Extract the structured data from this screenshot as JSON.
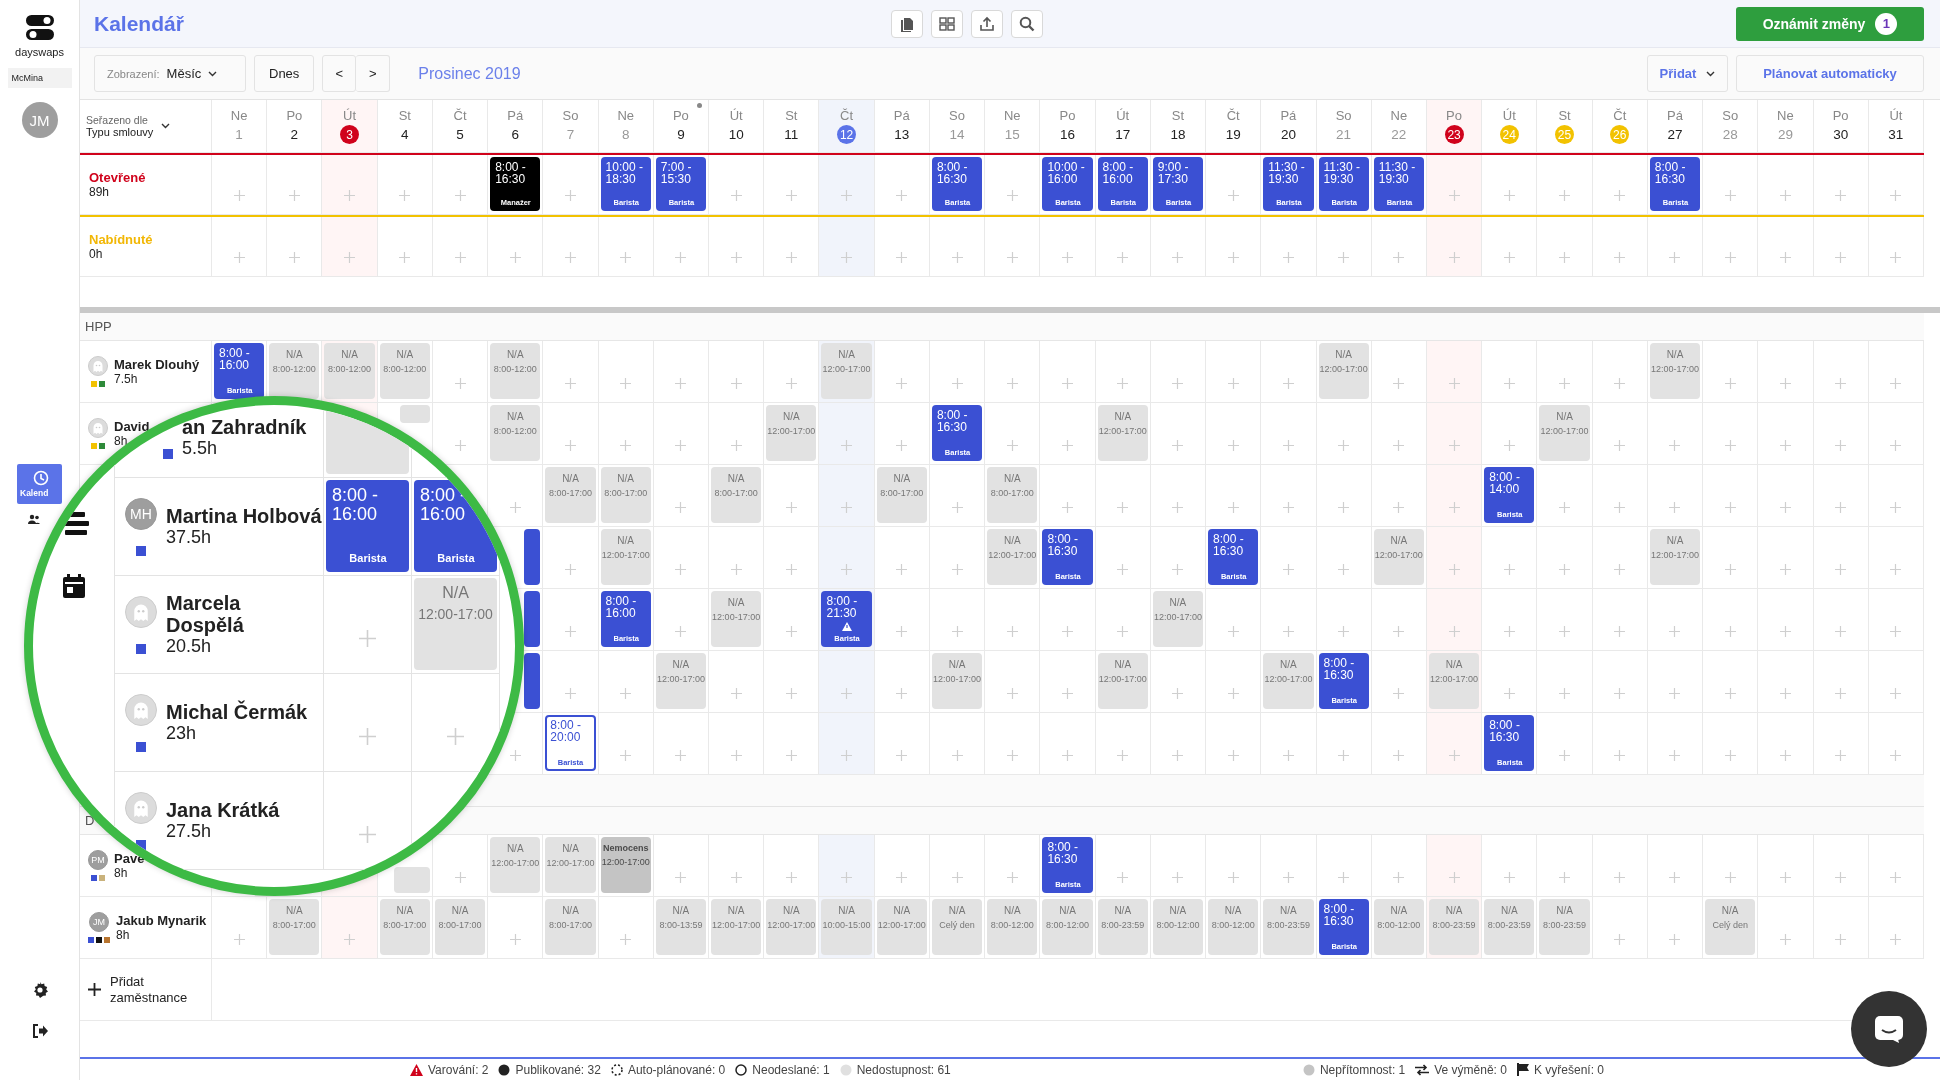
{
  "sidebar": {
    "logo": "dayswaps",
    "workspace": "McMina",
    "user_initials": "JM",
    "nav": [
      {
        "kind": "calendar",
        "label": "Kalend",
        "selected": true
      },
      {
        "kind": "people",
        "selected": false
      }
    ]
  },
  "topbar": {
    "title": "Kalendář",
    "publish": "Oznámit změny",
    "publish_count": "1"
  },
  "toolbar": {
    "view_label": "Zobrazení:",
    "view_value": "Měsíc",
    "today": "Dnes",
    "prev": "<",
    "next": ">",
    "period": "Prosinec 2019",
    "add": "Přidat",
    "auto": "Plánovat automaticky"
  },
  "sort": {
    "label": "Seřazeno dle",
    "value": "Typu smlouvy"
  },
  "days": [
    {
      "weekday": "Ne",
      "day": "1",
      "kind": "weekend",
      "marked": false
    },
    {
      "weekday": "Po",
      "day": "2",
      "kind": "plain",
      "marked": false
    },
    {
      "weekday": "Út",
      "day": "3",
      "kind": "holiday",
      "marked": false
    },
    {
      "weekday": "St",
      "day": "4",
      "kind": "plain",
      "marked": false
    },
    {
      "weekday": "Čt",
      "day": "5",
      "kind": "plain",
      "marked": false
    },
    {
      "weekday": "Pá",
      "day": "6",
      "kind": "plain",
      "marked": false
    },
    {
      "weekday": "So",
      "day": "7",
      "kind": "weekend",
      "marked": false
    },
    {
      "weekday": "Ne",
      "day": "8",
      "kind": "weekend",
      "marked": false
    },
    {
      "weekday": "Po",
      "day": "9",
      "kind": "plain",
      "marked": true
    },
    {
      "weekday": "Út",
      "day": "10",
      "kind": "plain",
      "marked": false
    },
    {
      "weekday": "St",
      "day": "11",
      "kind": "plain",
      "marked": false
    },
    {
      "weekday": "Čt",
      "day": "12",
      "kind": "today",
      "marked": false
    },
    {
      "weekday": "Pá",
      "day": "13",
      "kind": "plain",
      "marked": false
    },
    {
      "weekday": "So",
      "day": "14",
      "kind": "weekend",
      "marked": false
    },
    {
      "weekday": "Ne",
      "day": "15",
      "kind": "weekend",
      "marked": false
    },
    {
      "weekday": "Po",
      "day": "16",
      "kind": "plain",
      "marked": false
    },
    {
      "weekday": "Út",
      "day": "17",
      "kind": "plain",
      "marked": false
    },
    {
      "weekday": "St",
      "day": "18",
      "kind": "plain",
      "marked": false
    },
    {
      "weekday": "Čt",
      "day": "19",
      "kind": "plain",
      "marked": false
    },
    {
      "weekday": "Pá",
      "day": "20",
      "kind": "plain",
      "marked": false
    },
    {
      "weekday": "So",
      "day": "21",
      "kind": "weekend",
      "marked": false
    },
    {
      "weekday": "Ne",
      "day": "22",
      "kind": "weekend",
      "marked": false
    },
    {
      "weekday": "Po",
      "day": "23",
      "kind": "holiday",
      "marked": false
    },
    {
      "weekday": "Út",
      "day": "24",
      "kind": "leave",
      "marked": false
    },
    {
      "weekday": "St",
      "day": "25",
      "kind": "leave",
      "marked": false
    },
    {
      "weekday": "Čt",
      "day": "26",
      "kind": "leave",
      "marked": false
    },
    {
      "weekday": "Pá",
      "day": "27",
      "kind": "plain",
      "marked": false
    },
    {
      "weekday": "So",
      "day": "28",
      "kind": "weekend",
      "marked": false
    },
    {
      "weekday": "Ne",
      "day": "29",
      "kind": "weekend",
      "marked": false
    },
    {
      "weekday": "Po",
      "day": "30",
      "kind": "plain",
      "marked": false
    },
    {
      "weekday": "Út",
      "day": "31",
      "kind": "plain",
      "marked": false
    }
  ],
  "open_rows": [
    {
      "kind": "open",
      "label": "Otevřené",
      "hours": "89h",
      "cells": [
        {
          "kind": "add"
        },
        {
          "kind": "add"
        },
        {
          "kind": "add"
        },
        {
          "kind": "add"
        },
        {
          "kind": "add"
        },
        {
          "kind": "shift",
          "time": "8:00 - 16:30",
          "role": "Manažer",
          "color": "#000000"
        },
        {
          "kind": "add"
        },
        {
          "kind": "shift",
          "time": "10:00 - 18:30",
          "role": "Barista",
          "color": "#3b50d3"
        },
        {
          "kind": "shift",
          "time": "7:00 - 15:30",
          "role": "Barista",
          "color": "#3b50d3"
        },
        {
          "kind": "add"
        },
        {
          "kind": "add"
        },
        {
          "kind": "add"
        },
        {
          "kind": "add"
        },
        {
          "kind": "shift",
          "time": "8:00 - 16:30",
          "role": "Barista",
          "color": "#3b50d3"
        },
        {
          "kind": "add"
        },
        {
          "kind": "shift",
          "time": "10:00 - 16:00",
          "role": "Barista",
          "color": "#3b50d3"
        },
        {
          "kind": "shift",
          "time": "8:00 - 16:00",
          "role": "Barista",
          "color": "#3b50d3"
        },
        {
          "kind": "shift",
          "time": "9:00 - 17:30",
          "role": "Barista",
          "color": "#3b50d3"
        },
        {
          "kind": "add"
        },
        {
          "kind": "shift",
          "time": "11:30 - 19:30",
          "role": "Barista",
          "color": "#3b50d3"
        },
        {
          "kind": "shift",
          "time": "11:30 - 19:30",
          "role": "Barista",
          "color": "#3b50d3"
        },
        {
          "kind": "shift",
          "time": "11:30 - 19:30",
          "role": "Barista",
          "color": "#3b50d3"
        },
        {
          "kind": "add"
        },
        {
          "kind": "add"
        },
        {
          "kind": "add"
        },
        {
          "kind": "add"
        },
        {
          "kind": "shift",
          "time": "8:00 - 16:30",
          "role": "Barista",
          "color": "#3b50d3"
        },
        {
          "kind": "add"
        },
        {
          "kind": "add"
        },
        {
          "kind": "add"
        },
        {
          "kind": "add"
        }
      ]
    },
    {
      "kind": "offered",
      "label": "Nabídnuté",
      "hours": "0h",
      "cells": [
        {
          "kind": "add"
        },
        {
          "kind": "add"
        },
        {
          "kind": "add"
        },
        {
          "kind": "add"
        },
        {
          "kind": "add"
        },
        {
          "kind": "add"
        },
        {
          "kind": "add"
        },
        {
          "kind": "add"
        },
        {
          "kind": "add"
        },
        {
          "kind": "add"
        },
        {
          "kind": "add"
        },
        {
          "kind": "add"
        },
        {
          "kind": "add"
        },
        {
          "kind": "add"
        },
        {
          "kind": "add"
        },
        {
          "kind": "add"
        },
        {
          "kind": "add"
        },
        {
          "kind": "add"
        },
        {
          "kind": "add"
        },
        {
          "kind": "add"
        },
        {
          "kind": "add"
        },
        {
          "kind": "add"
        },
        {
          "kind": "add"
        },
        {
          "kind": "add"
        },
        {
          "kind": "add"
        },
        {
          "kind": "add"
        },
        {
          "kind": "add"
        },
        {
          "kind": "add"
        },
        {
          "kind": "add"
        },
        {
          "kind": "add"
        },
        {
          "kind": "add"
        }
      ]
    }
  ],
  "sections": [
    {
      "title": "HPP",
      "employees": [
        {
          "name": "Marek Dlouhý",
          "hours": "7.5h",
          "avatar": {
            "kind": "ghost"
          },
          "tags": [
            {
              "color": "#f2c200"
            },
            {
              "color": "#2e8b3a"
            }
          ],
          "cells": [
            {
              "kind": "shift",
              "time": "8:00 - 16:00",
              "role": "Barista",
              "color": "#3b50d3"
            },
            {
              "kind": "na",
              "label": "N/A",
              "time": "8:00-12:00"
            },
            {
              "kind": "na",
              "label": "N/A",
              "time": "8:00-12:00"
            },
            {
              "kind": "na",
              "label": "N/A",
              "time": "8:00-12:00"
            },
            {
              "kind": "add"
            },
            {
              "kind": "na",
              "label": "N/A",
              "time": "8:00-12:00"
            },
            {
              "kind": "add"
            },
            {
              "kind": "add"
            },
            {
              "kind": "add"
            },
            {
              "kind": "add"
            },
            {
              "kind": "add"
            },
            {
              "kind": "na",
              "label": "N/A",
              "time": "12:00-17:00"
            },
            {
              "kind": "add"
            },
            {
              "kind": "add"
            },
            {
              "kind": "add"
            },
            {
              "kind": "add"
            },
            {
              "kind": "add"
            },
            {
              "kind": "add"
            },
            {
              "kind": "add"
            },
            {
              "kind": "add"
            },
            {
              "kind": "na",
              "label": "N/A",
              "time": "12:00-17:00"
            },
            {
              "kind": "add"
            },
            {
              "kind": "add"
            },
            {
              "kind": "add"
            },
            {
              "kind": "add"
            },
            {
              "kind": "add"
            },
            {
              "kind": "na",
              "label": "N/A",
              "time": "12:00-17:00"
            },
            {
              "kind": "add"
            },
            {
              "kind": "add"
            },
            {
              "kind": "add"
            },
            {
              "kind": "add"
            }
          ]
        },
        {
          "name": "David",
          "hours": "8h",
          "avatar": {
            "kind": "ghost"
          },
          "tags": [
            {
              "color": "#f2c200"
            },
            {
              "color": "#2e8b3a"
            }
          ],
          "cells": [
            {
              "kind": "empty"
            },
            {
              "kind": "empty"
            },
            {
              "kind": "empty"
            },
            {
              "kind": "part_na"
            },
            {
              "kind": "add"
            },
            {
              "kind": "na",
              "label": "N/A",
              "time": "8:00-12:00"
            },
            {
              "kind": "add"
            },
            {
              "kind": "add"
            },
            {
              "kind": "add"
            },
            {
              "kind": "add"
            },
            {
              "kind": "na",
              "label": "N/A",
              "time": "12:00-17:00"
            },
            {
              "kind": "add"
            },
            {
              "kind": "add"
            },
            {
              "kind": "shift",
              "time": "8:00 - 16:30",
              "role": "Barista",
              "color": "#3b50d3"
            },
            {
              "kind": "add"
            },
            {
              "kind": "add"
            },
            {
              "kind": "na",
              "label": "N/A",
              "time": "12:00-17:00"
            },
            {
              "kind": "add"
            },
            {
              "kind": "add"
            },
            {
              "kind": "add"
            },
            {
              "kind": "add"
            },
            {
              "kind": "add"
            },
            {
              "kind": "add"
            },
            {
              "kind": "add"
            },
            {
              "kind": "na",
              "label": "N/A",
              "time": "12:00-17:00"
            },
            {
              "kind": "add"
            },
            {
              "kind": "add"
            },
            {
              "kind": "add"
            },
            {
              "kind": "add"
            },
            {
              "kind": "add"
            },
            {
              "kind": "add"
            }
          ]
        },
        {
          "cells": [
            {
              "kind": "empty"
            },
            {
              "kind": "empty"
            },
            {
              "kind": "hidden"
            },
            {
              "kind": "empty"
            },
            {
              "kind": "empty"
            },
            {
              "kind": "add"
            },
            {
              "kind": "na",
              "label": "N/A",
              "time": "8:00-17:00"
            },
            {
              "kind": "na",
              "label": "N/A",
              "time": "8:00-17:00"
            },
            {
              "kind": "add"
            },
            {
              "kind": "na",
              "label": "N/A",
              "time": "8:00-17:00"
            },
            {
              "kind": "add"
            },
            {
              "kind": "add"
            },
            {
              "kind": "na",
              "label": "N/A",
              "time": "8:00-17:00"
            },
            {
              "kind": "add"
            },
            {
              "kind": "na",
              "label": "N/A",
              "time": "8:00-17:00"
            },
            {
              "kind": "add"
            },
            {
              "kind": "add"
            },
            {
              "kind": "add"
            },
            {
              "kind": "add"
            },
            {
              "kind": "add"
            },
            {
              "kind": "add"
            },
            {
              "kind": "add"
            },
            {
              "kind": "add"
            },
            {
              "kind": "shift",
              "time": "8:00 - 14:00",
              "role": "Barista",
              "color": "#3b50d3"
            },
            {
              "kind": "add"
            },
            {
              "kind": "add"
            },
            {
              "kind": "add"
            },
            {
              "kind": "add"
            },
            {
              "kind": "add"
            },
            {
              "kind": "add"
            },
            {
              "kind": "add"
            }
          ]
        },
        {
          "cells": [
            {
              "kind": "empty"
            },
            {
              "kind": "empty"
            },
            {
              "kind": "hidden"
            },
            {
              "kind": "empty"
            },
            {
              "kind": "empty"
            },
            {
              "kind": "part_shift",
              "color": "#3b50d3"
            },
            {
              "kind": "add"
            },
            {
              "kind": "na",
              "label": "N/A",
              "time": "12:00-17:00"
            },
            {
              "kind": "add"
            },
            {
              "kind": "add"
            },
            {
              "kind": "add"
            },
            {
              "kind": "add"
            },
            {
              "kind": "add"
            },
            {
              "kind": "add"
            },
            {
              "kind": "na",
              "label": "N/A",
              "time": "12:00-17:00"
            },
            {
              "kind": "shift",
              "time": "8:00 - 16:30",
              "role": "Barista",
              "color": "#3b50d3"
            },
            {
              "kind": "add"
            },
            {
              "kind": "add"
            },
            {
              "kind": "shift",
              "time": "8:00 - 16:30",
              "role": "Barista",
              "color": "#3b50d3"
            },
            {
              "kind": "add"
            },
            {
              "kind": "add"
            },
            {
              "kind": "na",
              "label": "N/A",
              "time": "12:00-17:00"
            },
            {
              "kind": "add"
            },
            {
              "kind": "add"
            },
            {
              "kind": "add"
            },
            {
              "kind": "add"
            },
            {
              "kind": "na",
              "label": "N/A",
              "time": "12:00-17:00"
            },
            {
              "kind": "add"
            },
            {
              "kind": "add"
            },
            {
              "kind": "add"
            },
            {
              "kind": "add"
            }
          ]
        },
        {
          "cells": [
            {
              "kind": "empty"
            },
            {
              "kind": "empty"
            },
            {
              "kind": "hidden"
            },
            {
              "kind": "empty"
            },
            {
              "kind": "empty"
            },
            {
              "kind": "part_shift",
              "color": "#3b50d3"
            },
            {
              "kind": "add"
            },
            {
              "kind": "shift",
              "time": "8:00 - 16:00",
              "role": "Barista",
              "color": "#3b50d3"
            },
            {
              "kind": "add"
            },
            {
              "kind": "na",
              "label": "N/A",
              "time": "12:00-17:00"
            },
            {
              "kind": "add"
            },
            {
              "kind": "alert",
              "time": "8:00 - 21:30",
              "role": "Barista",
              "color": "#3b50d3"
            },
            {
              "kind": "add"
            },
            {
              "kind": "add"
            },
            {
              "kind": "add"
            },
            {
              "kind": "add"
            },
            {
              "kind": "add"
            },
            {
              "kind": "na",
              "label": "N/A",
              "time": "12:00-17:00"
            },
            {
              "kind": "add"
            },
            {
              "kind": "add"
            },
            {
              "kind": "add"
            },
            {
              "kind": "add"
            },
            {
              "kind": "add"
            },
            {
              "kind": "add"
            },
            {
              "kind": "add"
            },
            {
              "kind": "add"
            },
            {
              "kind": "add"
            },
            {
              "kind": "add"
            },
            {
              "kind": "add"
            },
            {
              "kind": "add"
            },
            {
              "kind": "add"
            }
          ]
        },
        {
          "cells": [
            {
              "kind": "empty"
            },
            {
              "kind": "empty"
            },
            {
              "kind": "hidden"
            },
            {
              "kind": "empty"
            },
            {
              "kind": "empty"
            },
            {
              "kind": "part_shift",
              "color": "#3b50d3"
            },
            {
              "kind": "add"
            },
            {
              "kind": "add"
            },
            {
              "kind": "na",
              "label": "N/A",
              "time": "12:00-17:00"
            },
            {
              "kind": "add"
            },
            {
              "kind": "add"
            },
            {
              "kind": "add"
            },
            {
              "kind": "add"
            },
            {
              "kind": "na",
              "label": "N/A",
              "time": "12:00-17:00"
            },
            {
              "kind": "add"
            },
            {
              "kind": "add"
            },
            {
              "kind": "na",
              "label": "N/A",
              "time": "12:00-17:00"
            },
            {
              "kind": "add"
            },
            {
              "kind": "add"
            },
            {
              "kind": "na",
              "label": "N/A",
              "time": "12:00-17:00"
            },
            {
              "kind": "shift",
              "time": "8:00 - 16:30",
              "role": "Barista",
              "color": "#3b50d3"
            },
            {
              "kind": "add"
            },
            {
              "kind": "na",
              "label": "N/A",
              "time": "12:00-17:00"
            },
            {
              "kind": "add"
            },
            {
              "kind": "add"
            },
            {
              "kind": "add"
            },
            {
              "kind": "add"
            },
            {
              "kind": "add"
            },
            {
              "kind": "add"
            },
            {
              "kind": "add"
            },
            {
              "kind": "add"
            }
          ]
        },
        {
          "cells": [
            {
              "kind": "empty"
            },
            {
              "kind": "empty"
            },
            {
              "kind": "empty"
            },
            {
              "kind": "empty"
            },
            {
              "kind": "empty"
            },
            {
              "kind": "add"
            },
            {
              "kind": "draft",
              "time": "8:00 - 20:00",
              "role": "Barista",
              "color": "#3b50d3"
            },
            {
              "kind": "add"
            },
            {
              "kind": "add"
            },
            {
              "kind": "add"
            },
            {
              "kind": "add"
            },
            {
              "kind": "add"
            },
            {
              "kind": "add"
            },
            {
              "kind": "add"
            },
            {
              "kind": "add"
            },
            {
              "kind": "add"
            },
            {
              "kind": "add"
            },
            {
              "kind": "add"
            },
            {
              "kind": "add"
            },
            {
              "kind": "add"
            },
            {
              "kind": "add"
            },
            {
              "kind": "add"
            },
            {
              "kind": "add"
            },
            {
              "kind": "shift",
              "time": "8:00 - 16:30",
              "role": "Barista",
              "color": "#3b50d3"
            },
            {
              "kind": "add"
            },
            {
              "kind": "add"
            },
            {
              "kind": "add"
            },
            {
              "kind": "add"
            },
            {
              "kind": "add"
            },
            {
              "kind": "add"
            },
            {
              "kind": "add"
            }
          ]
        }
      ]
    },
    {
      "title": "D",
      "employees": [
        {
          "name": "Pave",
          "hours": "8h",
          "avatar": {
            "kind": "initials",
            "text": "PM"
          },
          "tags": [
            {
              "color": "#3b50d3"
            },
            {
              "color": "#c9b27c"
            }
          ],
          "cells": [
            {
              "kind": "empty"
            },
            {
              "kind": "empty"
            },
            {
              "kind": "empty"
            },
            {
              "kind": "part_na_low"
            },
            {
              "kind": "add"
            },
            {
              "kind": "na",
              "label": "N/A",
              "time": "12:00-17:00"
            },
            {
              "kind": "na",
              "label": "N/A",
              "time": "12:00-17:00"
            },
            {
              "kind": "sick",
              "label": "Nemocens",
              "time": "12:00-17:00"
            },
            {
              "kind": "add"
            },
            {
              "kind": "add"
            },
            {
              "kind": "add"
            },
            {
              "kind": "add"
            },
            {
              "kind": "add"
            },
            {
              "kind": "add"
            },
            {
              "kind": "add"
            },
            {
              "kind": "shift",
              "time": "8:00 - 16:30",
              "role": "Barista",
              "color": "#3b50d3"
            },
            {
              "kind": "add"
            },
            {
              "kind": "add"
            },
            {
              "kind": "add"
            },
            {
              "kind": "add"
            },
            {
              "kind": "add"
            },
            {
              "kind": "add"
            },
            {
              "kind": "add"
            },
            {
              "kind": "add"
            },
            {
              "kind": "add"
            },
            {
              "kind": "add"
            },
            {
              "kind": "add"
            },
            {
              "kind": "add"
            },
            {
              "kind": "add"
            },
            {
              "kind": "add"
            },
            {
              "kind": "add"
            }
          ]
        },
        {
          "name": "Jakub Mynarik",
          "hours": "8h",
          "avatar": {
            "kind": "initials",
            "text": "JM"
          },
          "tags": [
            {
              "color": "#3b50d3"
            },
            {
              "color": "#111111"
            },
            {
              "color": "#b8752f"
            }
          ],
          "cells": [
            {
              "kind": "add"
            },
            {
              "kind": "na",
              "label": "N/A",
              "time": "8:00-17:00"
            },
            {
              "kind": "add"
            },
            {
              "kind": "na",
              "label": "N/A",
              "time": "8:00-17:00"
            },
            {
              "kind": "na",
              "label": "N/A",
              "time": "8:00-17:00"
            },
            {
              "kind": "add"
            },
            {
              "kind": "na",
              "label": "N/A",
              "time": "8:00-17:00"
            },
            {
              "kind": "add"
            },
            {
              "kind": "na",
              "label": "N/A",
              "time": "8:00-13:59"
            },
            {
              "kind": "na",
              "label": "N/A",
              "time": "12:00-17:00"
            },
            {
              "kind": "na",
              "label": "N/A",
              "time": "12:00-17:00"
            },
            {
              "kind": "na",
              "label": "N/A",
              "time": "10:00-15:00"
            },
            {
              "kind": "na",
              "label": "N/A",
              "time": "12:00-17:00"
            },
            {
              "kind": "na",
              "label": "N/A",
              "time": "Celý den"
            },
            {
              "kind": "na",
              "label": "N/A",
              "time": "8:00-12:00"
            },
            {
              "kind": "na",
              "label": "N/A",
              "time": "8:00-12:00"
            },
            {
              "kind": "na",
              "label": "N/A",
              "time": "8:00-23:59"
            },
            {
              "kind": "na",
              "label": "N/A",
              "time": "8:00-12:00"
            },
            {
              "kind": "na",
              "label": "N/A",
              "time": "8:00-12:00"
            },
            {
              "kind": "na",
              "label": "N/A",
              "time": "8:00-23:59"
            },
            {
              "kind": "shift",
              "time": "8:00 - 16:30",
              "role": "Barista",
              "color": "#3b50d3"
            },
            {
              "kind": "na",
              "label": "N/A",
              "time": "8:00-12:00"
            },
            {
              "kind": "na",
              "label": "N/A",
              "time": "8:00-23:59"
            },
            {
              "kind": "na",
              "label": "N/A",
              "time": "8:00-23:59"
            },
            {
              "kind": "na",
              "label": "N/A",
              "time": "8:00-23:59"
            },
            {
              "kind": "add"
            },
            {
              "kind": "add"
            },
            {
              "kind": "na",
              "label": "N/A",
              "time": "Celý den"
            },
            {
              "kind": "add"
            },
            {
              "kind": "add"
            },
            {
              "kind": "add"
            }
          ]
        }
      ]
    }
  ],
  "add_employee": "Přidat zaměstnance",
  "lens": {
    "rows": [
      {
        "name": "an Zahradník",
        "hours": "5.5h",
        "tags": [
          {
            "color": "#3b50d3"
          }
        ],
        "cells": [
          {
            "kind": "part_na"
          },
          {
            "kind": "empty"
          }
        ]
      },
      {
        "name": "Martina Holbová",
        "hours": "37.5h",
        "avatar": {
          "kind": "initials",
          "text": "MH"
        },
        "tags": [
          {
            "color": "#3b50d3"
          }
        ],
        "cells": [
          {
            "kind": "shift",
            "time": "8:00 - 16:00",
            "role": "Barista",
            "color": "#3b50d3"
          },
          {
            "kind": "shift",
            "time": "8:00 - 16:00",
            "role": "Barista",
            "color": "#3b50d3"
          }
        ]
      },
      {
        "name": "Marcela Dospělá",
        "hours": "20.5h",
        "avatar": {
          "kind": "ghost"
        },
        "tags": [
          {
            "color": "#3b50d3"
          }
        ],
        "cells": [
          {
            "kind": "add"
          },
          {
            "kind": "na",
            "label": "N/A",
            "time": "12:00-17:00"
          }
        ]
      },
      {
        "name": "Michal Čermák",
        "hours": "23h",
        "avatar": {
          "kind": "ghost"
        },
        "tags": [
          {
            "color": "#3b50d3"
          }
        ],
        "cells": [
          {
            "kind": "add"
          },
          {
            "kind": "add"
          }
        ]
      },
      {
        "name": "Jana Krátká",
        "hours": "27.5h",
        "avatar": {
          "kind": "ghost"
        },
        "tags": [
          {
            "color": "#3b50d3"
          }
        ],
        "cells": [
          {
            "kind": "add"
          },
          {
            "kind": "empty"
          }
        ]
      }
    ]
  },
  "status_left": [
    {
      "kind": "warning",
      "text": "Varování: 2"
    },
    {
      "kind": "published",
      "text": "Publikované: 32"
    },
    {
      "kind": "auto",
      "text": "Auto-plánované: 0"
    },
    {
      "kind": "unsent",
      "text": "Neodeslané: 1"
    },
    {
      "kind": "unavailable",
      "text": "Nedostupnost: 61"
    }
  ],
  "status_right": [
    {
      "kind": "absence",
      "text": "Nepřítomnost: 1"
    },
    {
      "kind": "swap",
      "text": "Ve výměně: 0"
    },
    {
      "kind": "flag",
      "text": "K vyřešení: 0"
    }
  ]
}
